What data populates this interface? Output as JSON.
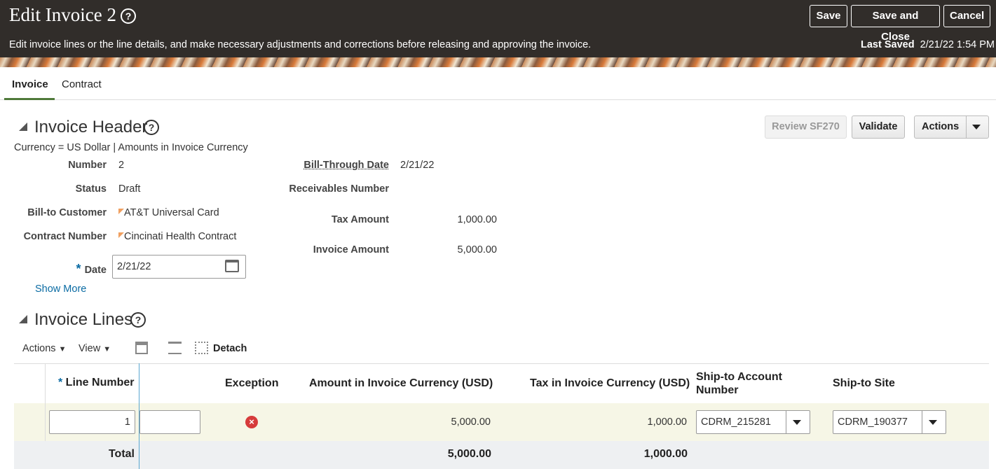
{
  "header": {
    "title": "Edit Invoice 2",
    "subtitle": "Edit invoice lines or the line details, and make necessary adjustments and corrections before releasing and approving the invoice.",
    "save": "Save",
    "save_close": "Save and Close",
    "cancel": "Cancel",
    "last_saved_label": "Last Saved",
    "last_saved_value": "2/21/22 1:54 PM"
  },
  "tabs": [
    "Invoice",
    "Contract"
  ],
  "invoice_header": {
    "title": "Invoice Header",
    "currency_line": "Currency = US Dollar | Amounts in Invoice Currency",
    "buttons": {
      "review": "Review SF270",
      "validate": "Validate",
      "actions": "Actions"
    },
    "fields": {
      "number_label": "Number",
      "number": "2",
      "status_label": "Status",
      "status": "Draft",
      "customer_label": "Bill-to Customer",
      "customer": "AT&T Universal Card",
      "contract_label": "Contract Number",
      "contract": "Cincinati Health Contract",
      "date_label": "Date",
      "date": "2/21/22",
      "bill_through_label": "Bill-Through Date",
      "bill_through": "2/21/22",
      "receivables_label": "Receivables Number",
      "tax_label": "Tax Amount",
      "tax": "1,000.00",
      "invoice_amount_label": "Invoice Amount",
      "invoice_amount": "5,000.00"
    },
    "show_more": "Show More"
  },
  "invoice_lines": {
    "title": "Invoice Lines",
    "toolbar": {
      "actions": "Actions",
      "view": "View",
      "detach": "Detach"
    },
    "columns": {
      "line_number": "Line Number",
      "exception": "Exception",
      "amount": "Amount in Invoice Currency (USD)",
      "tax": "Tax in Invoice Currency (USD)",
      "ship_account": "Ship-to Account Number",
      "ship_site": "Ship-to Site"
    },
    "rows": [
      {
        "line_number": "1",
        "amount": "5,000.00",
        "tax": "1,000.00",
        "ship_account": "CDRM_215281",
        "ship_site": "CDRM_190377"
      }
    ],
    "total_label": "Total",
    "total_amount": "5,000.00",
    "total_tax": "1,000.00"
  },
  "colors": {
    "topbar": "#312d2a",
    "link": "#0a6ba3",
    "row_highlight": "#f6f6e6"
  }
}
